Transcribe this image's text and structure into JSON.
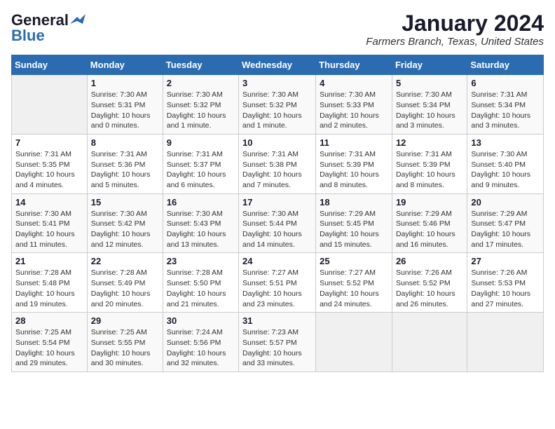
{
  "logo": {
    "line1": "General",
    "line2": "Blue"
  },
  "title": "January 2024",
  "location": "Farmers Branch, Texas, United States",
  "days_of_week": [
    "Sunday",
    "Monday",
    "Tuesday",
    "Wednesday",
    "Thursday",
    "Friday",
    "Saturday"
  ],
  "weeks": [
    [
      {
        "num": "",
        "info": ""
      },
      {
        "num": "1",
        "info": "Sunrise: 7:30 AM\nSunset: 5:31 PM\nDaylight: 10 hours\nand 0 minutes."
      },
      {
        "num": "2",
        "info": "Sunrise: 7:30 AM\nSunset: 5:32 PM\nDaylight: 10 hours\nand 1 minute."
      },
      {
        "num": "3",
        "info": "Sunrise: 7:30 AM\nSunset: 5:32 PM\nDaylight: 10 hours\nand 1 minute."
      },
      {
        "num": "4",
        "info": "Sunrise: 7:30 AM\nSunset: 5:33 PM\nDaylight: 10 hours\nand 2 minutes."
      },
      {
        "num": "5",
        "info": "Sunrise: 7:30 AM\nSunset: 5:34 PM\nDaylight: 10 hours\nand 3 minutes."
      },
      {
        "num": "6",
        "info": "Sunrise: 7:31 AM\nSunset: 5:34 PM\nDaylight: 10 hours\nand 3 minutes."
      }
    ],
    [
      {
        "num": "7",
        "info": "Sunrise: 7:31 AM\nSunset: 5:35 PM\nDaylight: 10 hours\nand 4 minutes."
      },
      {
        "num": "8",
        "info": "Sunrise: 7:31 AM\nSunset: 5:36 PM\nDaylight: 10 hours\nand 5 minutes."
      },
      {
        "num": "9",
        "info": "Sunrise: 7:31 AM\nSunset: 5:37 PM\nDaylight: 10 hours\nand 6 minutes."
      },
      {
        "num": "10",
        "info": "Sunrise: 7:31 AM\nSunset: 5:38 PM\nDaylight: 10 hours\nand 7 minutes."
      },
      {
        "num": "11",
        "info": "Sunrise: 7:31 AM\nSunset: 5:39 PM\nDaylight: 10 hours\nand 8 minutes."
      },
      {
        "num": "12",
        "info": "Sunrise: 7:31 AM\nSunset: 5:39 PM\nDaylight: 10 hours\nand 8 minutes."
      },
      {
        "num": "13",
        "info": "Sunrise: 7:30 AM\nSunset: 5:40 PM\nDaylight: 10 hours\nand 9 minutes."
      }
    ],
    [
      {
        "num": "14",
        "info": "Sunrise: 7:30 AM\nSunset: 5:41 PM\nDaylight: 10 hours\nand 11 minutes."
      },
      {
        "num": "15",
        "info": "Sunrise: 7:30 AM\nSunset: 5:42 PM\nDaylight: 10 hours\nand 12 minutes."
      },
      {
        "num": "16",
        "info": "Sunrise: 7:30 AM\nSunset: 5:43 PM\nDaylight: 10 hours\nand 13 minutes."
      },
      {
        "num": "17",
        "info": "Sunrise: 7:30 AM\nSunset: 5:44 PM\nDaylight: 10 hours\nand 14 minutes."
      },
      {
        "num": "18",
        "info": "Sunrise: 7:29 AM\nSunset: 5:45 PM\nDaylight: 10 hours\nand 15 minutes."
      },
      {
        "num": "19",
        "info": "Sunrise: 7:29 AM\nSunset: 5:46 PM\nDaylight: 10 hours\nand 16 minutes."
      },
      {
        "num": "20",
        "info": "Sunrise: 7:29 AM\nSunset: 5:47 PM\nDaylight: 10 hours\nand 17 minutes."
      }
    ],
    [
      {
        "num": "21",
        "info": "Sunrise: 7:28 AM\nSunset: 5:48 PM\nDaylight: 10 hours\nand 19 minutes."
      },
      {
        "num": "22",
        "info": "Sunrise: 7:28 AM\nSunset: 5:49 PM\nDaylight: 10 hours\nand 20 minutes."
      },
      {
        "num": "23",
        "info": "Sunrise: 7:28 AM\nSunset: 5:50 PM\nDaylight: 10 hours\nand 21 minutes."
      },
      {
        "num": "24",
        "info": "Sunrise: 7:27 AM\nSunset: 5:51 PM\nDaylight: 10 hours\nand 23 minutes."
      },
      {
        "num": "25",
        "info": "Sunrise: 7:27 AM\nSunset: 5:52 PM\nDaylight: 10 hours\nand 24 minutes."
      },
      {
        "num": "26",
        "info": "Sunrise: 7:26 AM\nSunset: 5:52 PM\nDaylight: 10 hours\nand 26 minutes."
      },
      {
        "num": "27",
        "info": "Sunrise: 7:26 AM\nSunset: 5:53 PM\nDaylight: 10 hours\nand 27 minutes."
      }
    ],
    [
      {
        "num": "28",
        "info": "Sunrise: 7:25 AM\nSunset: 5:54 PM\nDaylight: 10 hours\nand 29 minutes."
      },
      {
        "num": "29",
        "info": "Sunrise: 7:25 AM\nSunset: 5:55 PM\nDaylight: 10 hours\nand 30 minutes."
      },
      {
        "num": "30",
        "info": "Sunrise: 7:24 AM\nSunset: 5:56 PM\nDaylight: 10 hours\nand 32 minutes."
      },
      {
        "num": "31",
        "info": "Sunrise: 7:23 AM\nSunset: 5:57 PM\nDaylight: 10 hours\nand 33 minutes."
      },
      {
        "num": "",
        "info": ""
      },
      {
        "num": "",
        "info": ""
      },
      {
        "num": "",
        "info": ""
      }
    ]
  ]
}
